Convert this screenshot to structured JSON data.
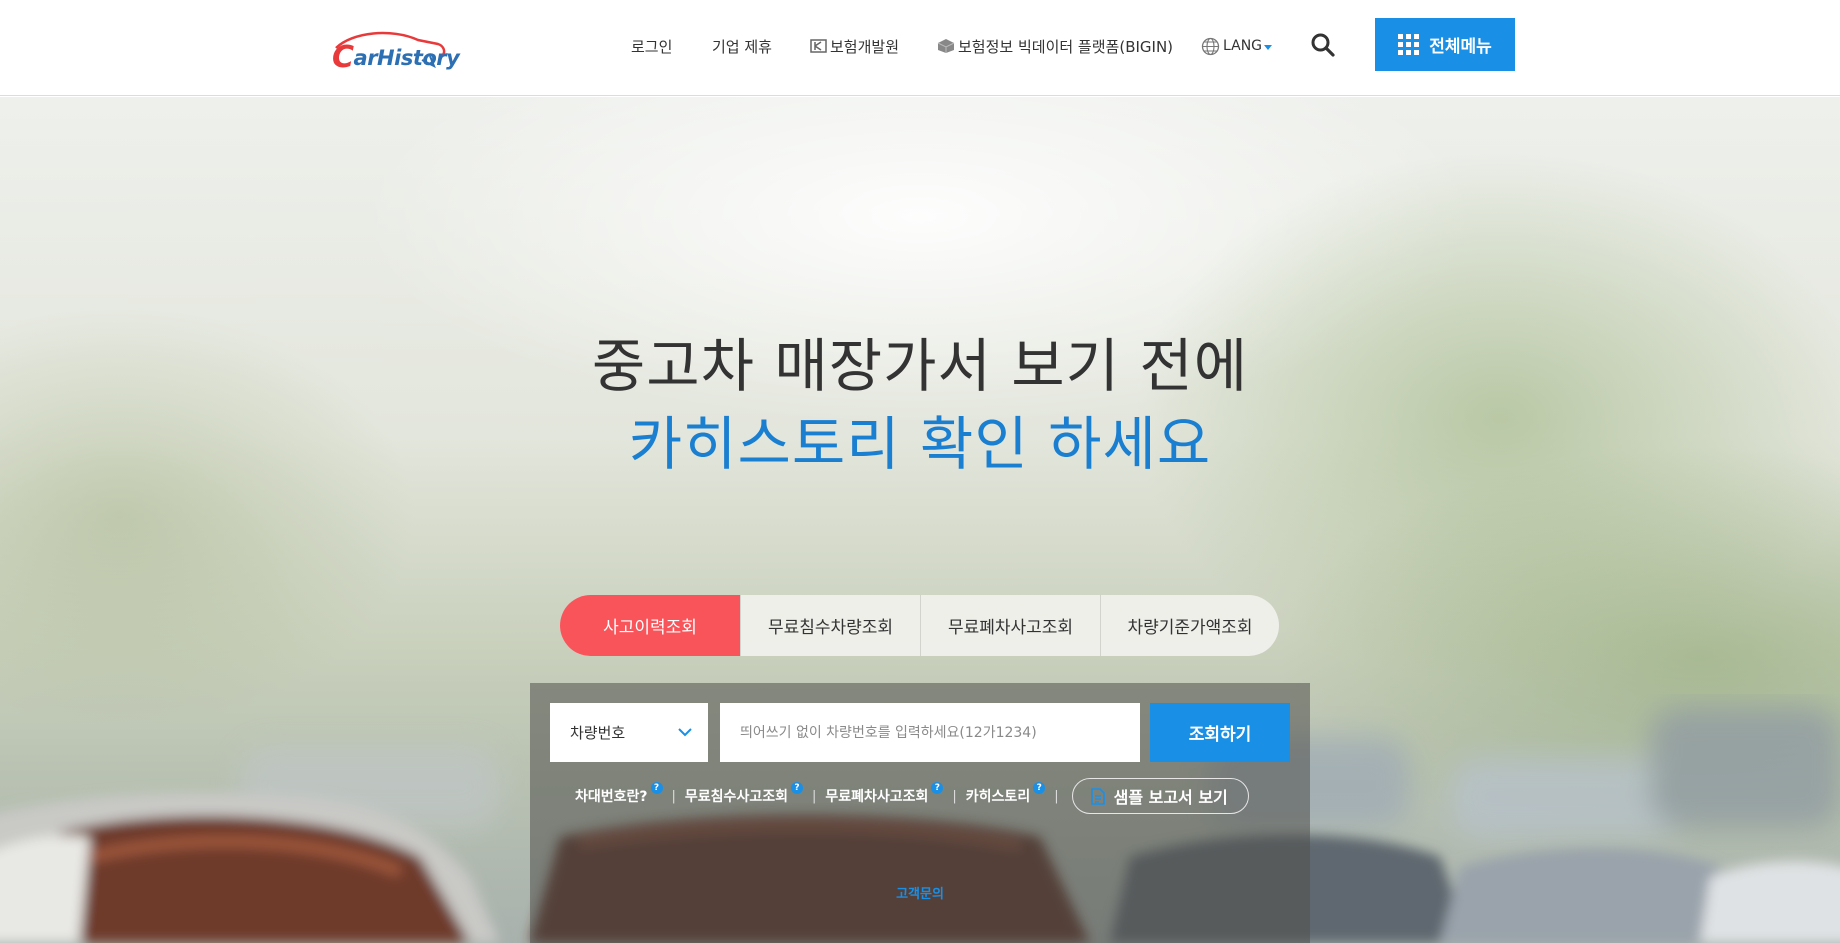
{
  "header": {
    "logo_text": "CarHistory",
    "nav": {
      "login": "로그인",
      "partnership": "기업 제휴",
      "kidi": "보험개발원",
      "bigin": "보험정보 빅데이터 플랫폼(BIGIN)",
      "lang": "LANG"
    },
    "search_icon": "search-icon",
    "all_menu": "전체메뉴"
  },
  "hero": {
    "headline_line1": "중고차 매장가서 보기 전에",
    "headline_line2": "카히스토리 확인 하세요"
  },
  "tabs": [
    {
      "label": "사고이력조회",
      "active": true
    },
    {
      "label": "무료침수차량조회",
      "active": false
    },
    {
      "label": "무료폐차사고조회",
      "active": false
    },
    {
      "label": "차량기준가액조회",
      "active": false
    }
  ],
  "search": {
    "select_value": "차량번호",
    "input_placeholder": "띄어쓰기 없이 차량번호를 입력하세요(12가1234)",
    "query_button": "조회하기"
  },
  "help_links": [
    {
      "label": "차대번호란?"
    },
    {
      "label": "무료침수사고조회"
    },
    {
      "label": "무료폐차사고조회"
    },
    {
      "label": "카히스토리"
    }
  ],
  "help_mark": "?",
  "separator": "|",
  "sample_report": "샘플 보고서 보기",
  "customer_inquiry": "고객문의",
  "colors": {
    "accent_blue": "#1a8fe6",
    "active_tab": "#f8545a",
    "headline_blue": "#1a7fd0",
    "logo_red": "#e83a3a"
  }
}
